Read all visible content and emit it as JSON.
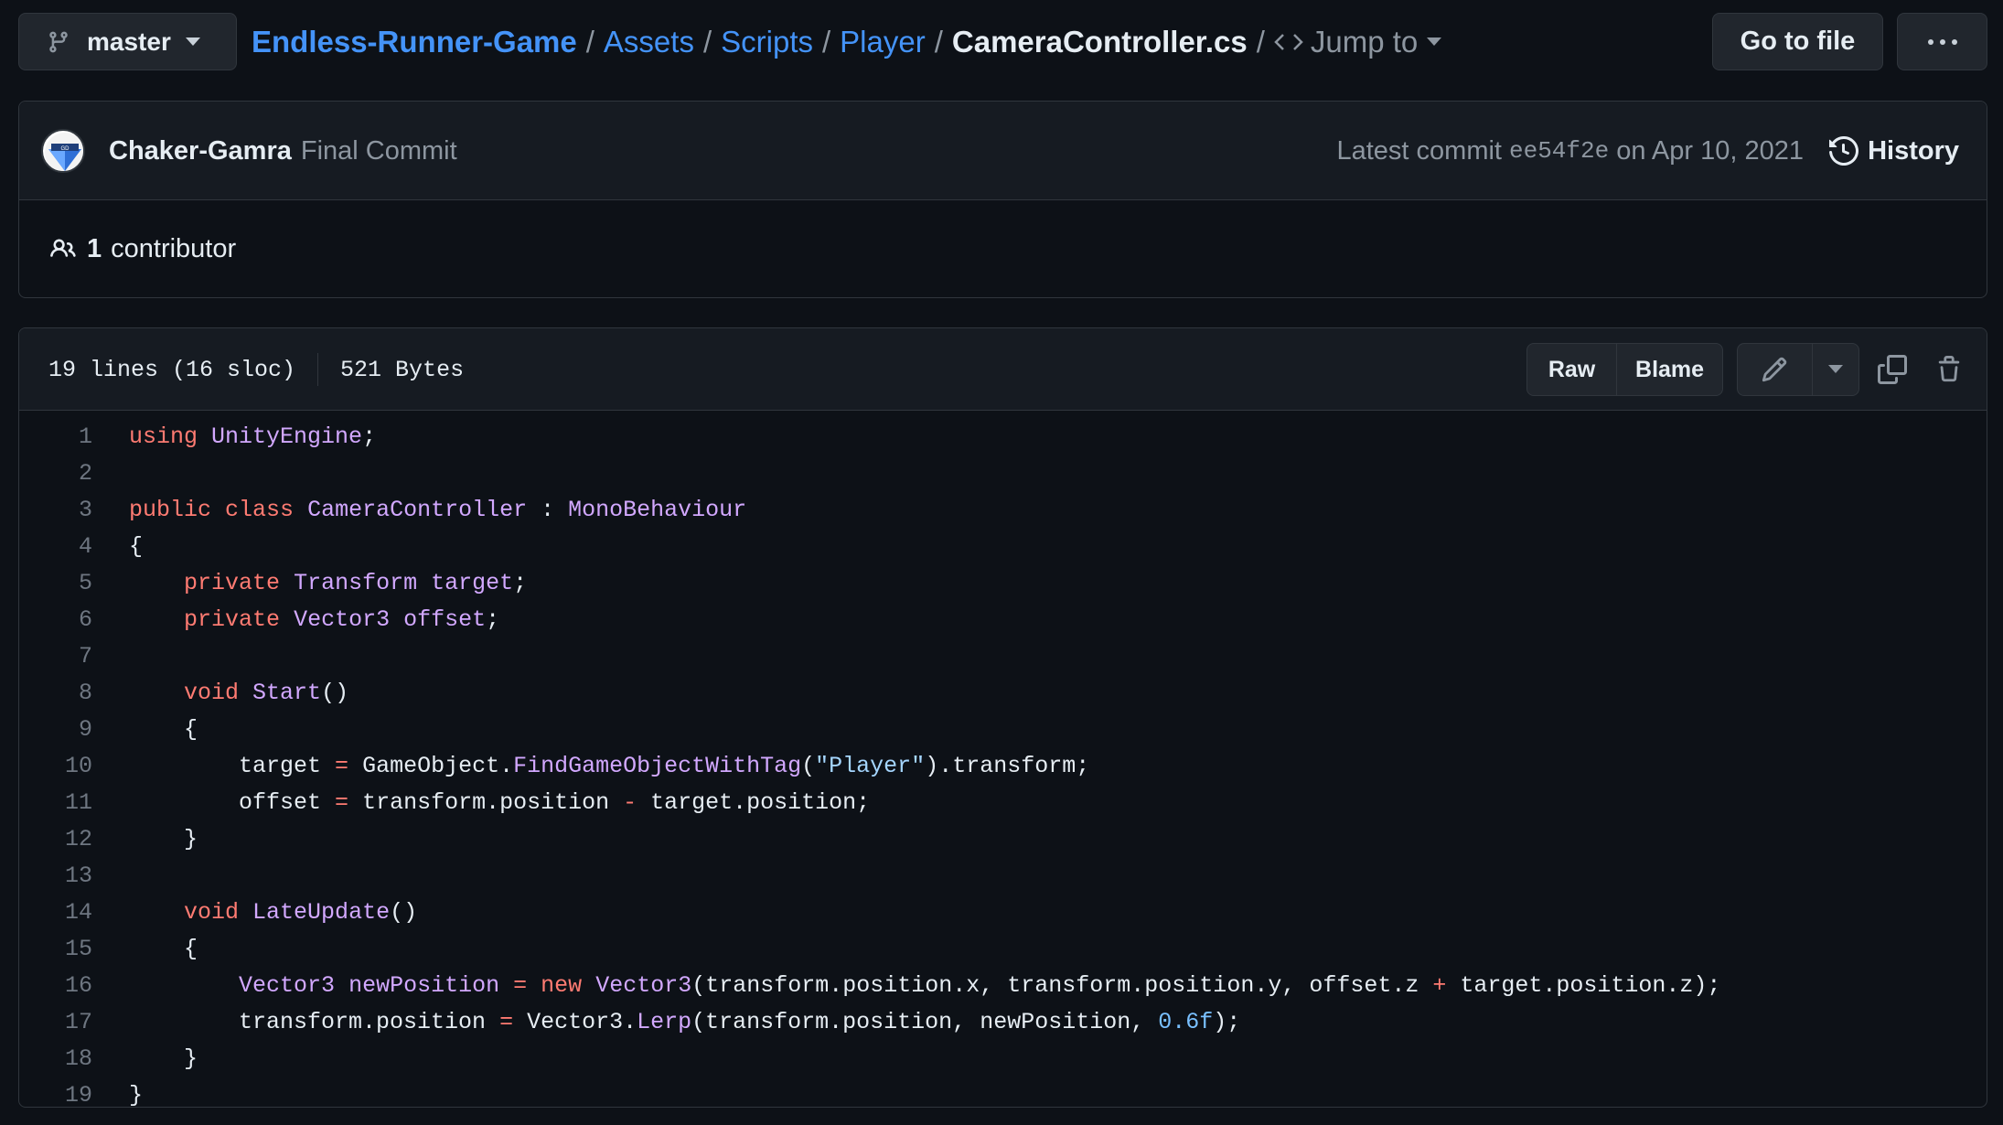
{
  "header": {
    "branch": "master",
    "breadcrumb": {
      "repo": "Endless-Runner-Game",
      "folders": [
        "Assets",
        "Scripts",
        "Player"
      ],
      "file": "CameraController.cs",
      "jump_label": "Jump to"
    },
    "goto_file_label": "Go to file"
  },
  "commit": {
    "author": "Chaker-Gamra",
    "message": "Final Commit",
    "latest_prefix": "Latest commit",
    "sha": "ee54f2e",
    "date_text": "on Apr 10, 2021",
    "history_label": "History",
    "contributors_count": "1",
    "contributors_label": "contributor"
  },
  "file": {
    "lines_info": "19 lines (16 sloc)",
    "size": "521 Bytes",
    "raw_label": "Raw",
    "blame_label": "Blame"
  },
  "code": [
    [
      [
        "k",
        "using"
      ],
      [
        "",
        ""
      ],
      [
        "t",
        "UnityEngine"
      ],
      [
        "",
        ";"
      ]
    ],
    [],
    [
      [
        "k",
        "public"
      ],
      [
        "",
        ""
      ],
      [
        "k",
        "class"
      ],
      [
        "",
        ""
      ],
      [
        "t",
        "CameraController"
      ],
      [
        "",
        " : "
      ],
      [
        "t",
        "MonoBehaviour"
      ]
    ],
    [
      [
        "",
        "{"
      ]
    ],
    [
      [
        "",
        "    "
      ],
      [
        "k",
        "private"
      ],
      [
        "",
        ""
      ],
      [
        "t",
        "Transform"
      ],
      [
        "",
        ""
      ],
      [
        "t",
        "target"
      ],
      [
        "",
        ";"
      ]
    ],
    [
      [
        "",
        "    "
      ],
      [
        "k",
        "private"
      ],
      [
        "",
        ""
      ],
      [
        "t",
        "Vector3"
      ],
      [
        "",
        ""
      ],
      [
        "t",
        "offset"
      ],
      [
        "",
        ";"
      ]
    ],
    [],
    [
      [
        "",
        "    "
      ],
      [
        "k",
        "void"
      ],
      [
        "",
        ""
      ],
      [
        "t",
        "Start"
      ],
      [
        "",
        "()"
      ]
    ],
    [
      [
        "",
        "    {"
      ]
    ],
    [
      [
        "",
        "        target "
      ],
      [
        "k",
        "="
      ],
      [
        "",
        " GameObject."
      ],
      [
        "t",
        "FindGameObjectWithTag"
      ],
      [
        "",
        "("
      ],
      [
        "s",
        "\"Player\""
      ],
      [
        "",
        ").transform;"
      ]
    ],
    [
      [
        "",
        "        offset "
      ],
      [
        "k",
        "="
      ],
      [
        "",
        " transform.position "
      ],
      [
        "k",
        "-"
      ],
      [
        "",
        " target.position;"
      ]
    ],
    [
      [
        "",
        "    }"
      ]
    ],
    [],
    [
      [
        "",
        "    "
      ],
      [
        "k",
        "void"
      ],
      [
        "",
        ""
      ],
      [
        "t",
        "LateUpdate"
      ],
      [
        "",
        "()"
      ]
    ],
    [
      [
        "",
        "    {"
      ]
    ],
    [
      [
        "",
        "        "
      ],
      [
        "t",
        "Vector3"
      ],
      [
        "",
        ""
      ],
      [
        "t",
        "newPosition"
      ],
      [
        "",
        ""
      ],
      [
        "k",
        "="
      ],
      [
        "",
        ""
      ],
      [
        "k",
        "new"
      ],
      [
        "",
        ""
      ],
      [
        "t",
        "Vector3"
      ],
      [
        "",
        "(transform.position.x, transform.position.y, offset.z "
      ],
      [
        "k",
        "+"
      ],
      [
        "",
        " target.position.z);"
      ]
    ],
    [
      [
        "",
        "        transform.position "
      ],
      [
        "k",
        "="
      ],
      [
        "",
        " Vector3."
      ],
      [
        "t",
        "Lerp"
      ],
      [
        "",
        "(transform.position, newPosition, "
      ],
      [
        "n",
        "0.6f"
      ],
      [
        "",
        ");"
      ]
    ],
    [
      [
        "",
        "    }"
      ]
    ],
    [
      [
        "",
        "}"
      ]
    ]
  ]
}
